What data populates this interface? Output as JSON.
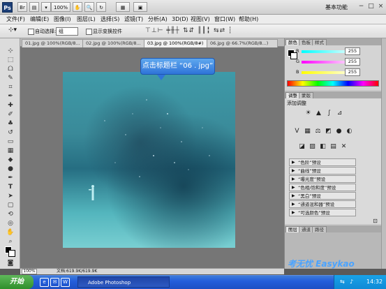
{
  "app": {
    "logo": "Ps",
    "zoom": "100%",
    "workspace": "基本功能",
    "controls": [
      "−",
      "□",
      "×"
    ]
  },
  "menu": [
    "文件(F)",
    "编辑(E)",
    "图像(I)",
    "图层(L)",
    "选择(S)",
    "滤镜(T)",
    "分析(A)",
    "3D(D)",
    "视图(V)",
    "窗口(W)",
    "帮助(H)"
  ],
  "options": {
    "auto_select": "自动选择:",
    "group_value": "组",
    "show_transform": "显示变换控件"
  },
  "doc_tabs": [
    "01.jpg @ 100%(RGB/8...",
    "02.jpg @ 100%(RGB/8...",
    "03.jpg @ 100%(RGB/8#)",
    "06.jpg @ 66.7%(RGB/8...)"
  ],
  "callout": "点击标题栏 “06 . jpg”",
  "status": {
    "zoom": "100%",
    "doc": "文档:619.9K/619.9K"
  },
  "panels": {
    "color_tabs": [
      "颜色",
      "色板",
      "样式"
    ],
    "channels": [
      {
        "label": "R",
        "value": "255",
        "color": "#e03030"
      },
      {
        "label": "G",
        "value": "255",
        "color": "#30c030"
      },
      {
        "label": "B",
        "value": "255",
        "color": "#3040e0"
      }
    ],
    "adjust_tabs": [
      "调整",
      "蒙版"
    ],
    "adjust_title": "添加调整",
    "presets": [
      "“色阶”预设",
      "“曲线”预设",
      "“曝光度”预设",
      "“色相/饱和度”预设",
      "“黑白”预设",
      "“通道混和器”预设",
      "“可选颜色”预设"
    ],
    "layer_tabs": [
      "图层",
      "通道",
      "路径"
    ]
  },
  "taskbar": {
    "start": "开始",
    "item": "Adobe Photoshop",
    "time": "14:32"
  },
  "watermark": "考无忧 Easykao"
}
